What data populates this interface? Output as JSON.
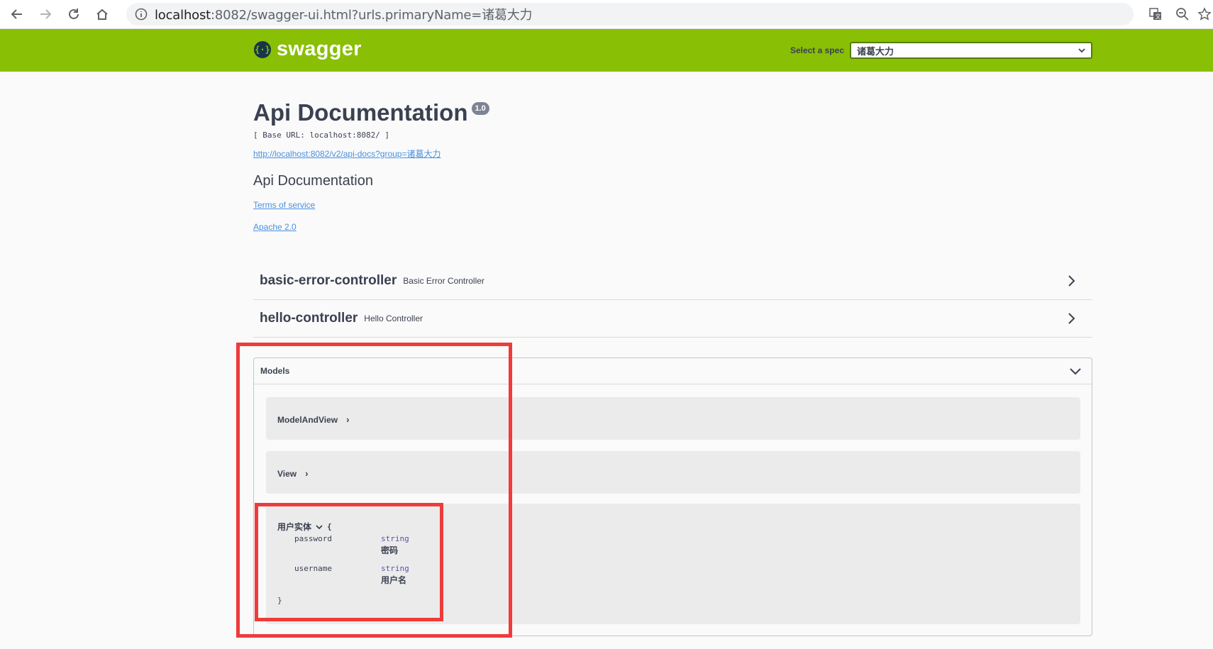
{
  "browser": {
    "url_host": "localhost",
    "url_rest": ":8082/swagger-ui.html?urls.primaryName=诸葛大力"
  },
  "topbar": {
    "brand": "swagger",
    "spec_label": "Select a spec",
    "spec_value": "诸葛大力",
    "color": "#89bf04"
  },
  "info": {
    "title": "Api Documentation",
    "version": "1.0",
    "base_url": "[ Base URL: localhost:8082/ ]",
    "docs_link": "http://localhost:8082/v2/api-docs?group=诸葛大力",
    "description": "Api Documentation",
    "terms": "Terms of service",
    "license": "Apache 2.0"
  },
  "tags": [
    {
      "name": "basic-error-controller",
      "description": "Basic Error Controller"
    },
    {
      "name": "hello-controller",
      "description": "Hello Controller"
    }
  ],
  "models": {
    "header": "Models",
    "items": [
      {
        "name": "ModelAndView"
      },
      {
        "name": "View"
      }
    ],
    "entity": {
      "name": "用户实体",
      "open_brace": "{",
      "close_brace": "}",
      "properties": [
        {
          "name": "password",
          "type": "string",
          "description": "密码"
        },
        {
          "name": "username",
          "type": "string",
          "description": "用户名"
        }
      ]
    }
  },
  "annotation_color": "#ef3b3b"
}
